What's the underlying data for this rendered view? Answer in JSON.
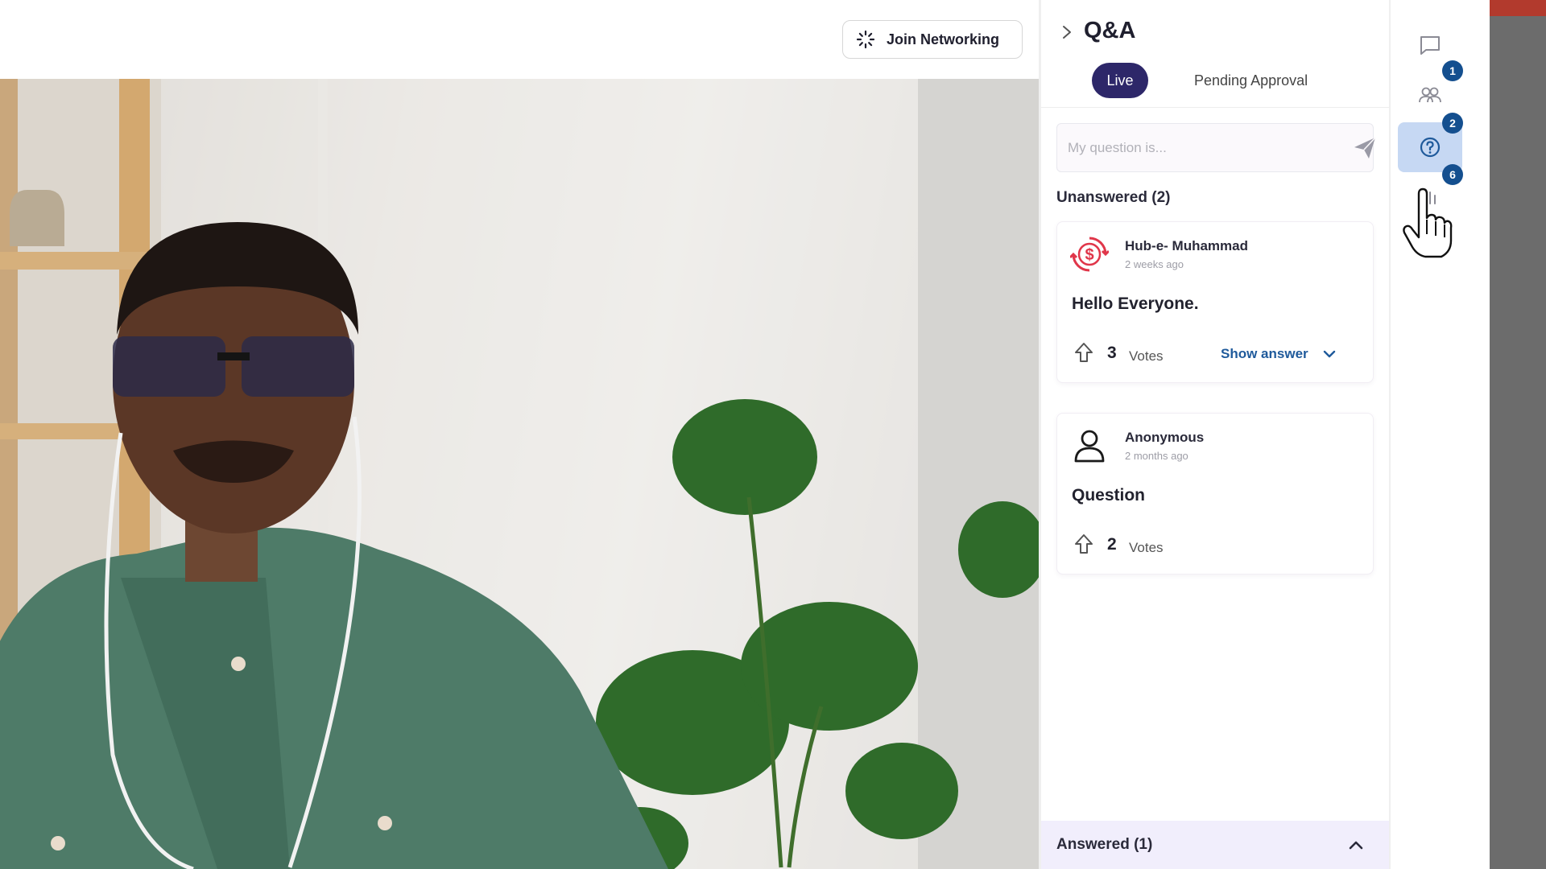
{
  "header": {
    "join_networking_label": "Join Networking"
  },
  "qa": {
    "title": "Q&A",
    "tabs": [
      {
        "label": "Live",
        "active": true
      },
      {
        "label": "Pending Approval",
        "active": false
      }
    ],
    "input_placeholder": "My question is...",
    "unanswered_label": "Unanswered (2)",
    "questions": [
      {
        "author": "Hub-e- Muhammad",
        "time": "2 weeks ago",
        "text": "Hello Everyone.",
        "votes": "3",
        "votes_label": "Votes",
        "show_answer": "Show answer",
        "avatar_icon": "dollar-sync-icon"
      },
      {
        "author": "Anonymous",
        "time": "2 months ago",
        "text": "Question",
        "votes": "2",
        "votes_label": "Votes",
        "avatar_icon": "user-icon"
      }
    ],
    "answered_label": "Answered (1)"
  },
  "sidebar": {
    "items": [
      {
        "icon": "chat-icon",
        "badge": ""
      },
      {
        "icon": "people-icon",
        "badge": "1"
      },
      {
        "icon": "question-icon",
        "badge": "2",
        "active": true
      },
      {
        "icon": "poll-icon",
        "badge": "6"
      }
    ]
  },
  "colors": {
    "accent": "#2d2769",
    "link": "#1f5a9b",
    "badge": "#144f8f",
    "active_sidebar": "#c6d8f3",
    "answered_bar": "#f1eefc",
    "avatar_red": "#e0364a"
  }
}
